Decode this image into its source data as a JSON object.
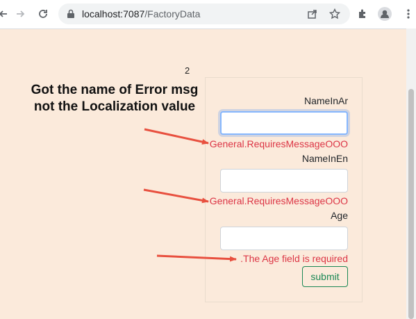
{
  "browser": {
    "url_host": "localhost:7087",
    "url_path": "/FactoryData",
    "icons": [
      "back-icon",
      "forward-icon",
      "reload-icon",
      "lock-icon",
      "share-icon",
      "star-icon",
      "extensions-icon",
      "profile-icon",
      "menu-icon"
    ]
  },
  "page": {
    "counter": "2"
  },
  "form": {
    "fields": [
      {
        "label": "NameInAr",
        "value": "",
        "error": "General.RequiresMessageOOO"
      },
      {
        "label": "NameInEn",
        "value": "",
        "error": "General.RequiresMessageOOO"
      },
      {
        "label": "Age",
        "value": "",
        "error": ".The Age field is required"
      }
    ],
    "submit_label": "submit"
  },
  "annotation": {
    "line1": "Got the name of Error msg",
    "line2": "not the Localization value"
  },
  "colors": {
    "background": "#fbeadb",
    "error": "#dc3545",
    "arrow": "#e8503f",
    "submit": "#198754",
    "focus": "#86b7fe"
  }
}
